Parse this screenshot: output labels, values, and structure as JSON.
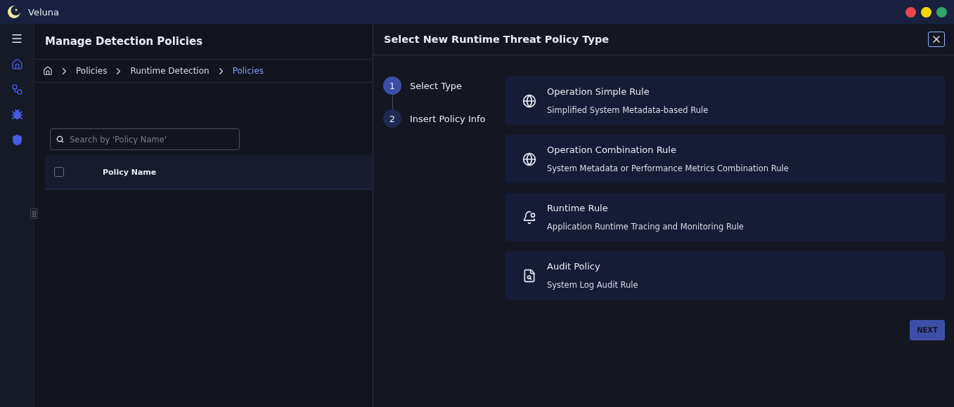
{
  "app": {
    "title": "Veluna"
  },
  "sidebar": {
    "items": [
      {
        "kind": "home"
      },
      {
        "kind": "flow"
      },
      {
        "kind": "bug"
      },
      {
        "kind": "shield"
      }
    ]
  },
  "page": {
    "title": "Manage Detection Policies",
    "breadcrumb": [
      {
        "label": "Policies",
        "selected": false
      },
      {
        "label": "Runtime Detection",
        "selected": false
      },
      {
        "label": "Policies",
        "selected": true
      }
    ],
    "search": {
      "placeholder": "Search by 'Policy Name'"
    },
    "table": {
      "select_all_checked": false,
      "columns": [
        "Policy Name"
      ]
    }
  },
  "drawer": {
    "title": "Select New Runtime Threat Policy Type",
    "steps": [
      {
        "number": "1",
        "label": "Select Type",
        "selected": true
      },
      {
        "number": "2",
        "label": "Insert Policy Info",
        "selected": false
      }
    ],
    "policy_types": [
      {
        "kind": "globe",
        "title": "Operation Simple Rule",
        "description": "Simplified System Metadata-based Rule"
      },
      {
        "kind": "globe",
        "title": "Operation Combination Rule",
        "description": "System Metadata or Performance Metrics Combination Rule"
      },
      {
        "kind": "bell",
        "title": "Runtime Rule",
        "description": "Application Runtime Tracing and Monitoring Rule"
      },
      {
        "kind": "file",
        "title": "Audit Policy",
        "description": "System Log Audit Rule"
      }
    ],
    "next_button": "NEXT"
  }
}
